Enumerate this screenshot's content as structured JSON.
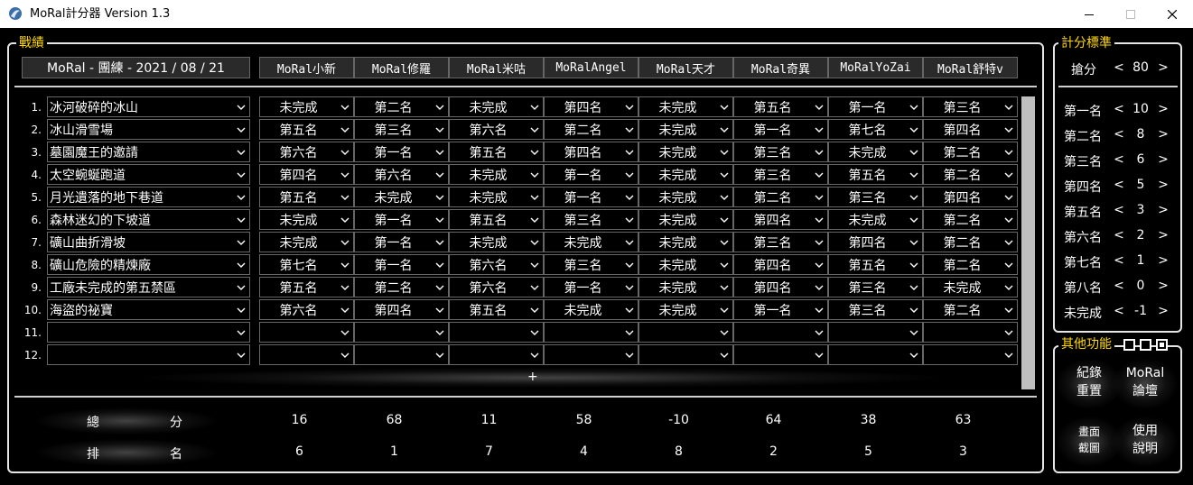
{
  "window": {
    "title": "MoRal計分器 Version 1.3"
  },
  "record": {
    "legend": "戰績",
    "title": "MoRal - 團練 - 2021 / 08 / 21"
  },
  "players": [
    "MoRal小新",
    "MoRal修羅",
    "MoRal米咕",
    "MoRalAngel",
    "MoRal天才",
    "MoRal奇異",
    "MoRalYoZai",
    "MoRal舒特v"
  ],
  "rows": [
    {
      "num": "1.",
      "track": "冰河破碎的冰山",
      "results": [
        "未完成",
        "第二名",
        "未完成",
        "第四名",
        "未完成",
        "第五名",
        "第一名",
        "第三名"
      ]
    },
    {
      "num": "2.",
      "track": "冰山滑雪場",
      "results": [
        "第五名",
        "第三名",
        "第六名",
        "第二名",
        "未完成",
        "第一名",
        "第七名",
        "第四名"
      ]
    },
    {
      "num": "3.",
      "track": "墓園魔王的邀請",
      "results": [
        "第六名",
        "第一名",
        "第五名",
        "第四名",
        "未完成",
        "第三名",
        "未完成",
        "第二名"
      ]
    },
    {
      "num": "4.",
      "track": "太空蜿蜒跑道",
      "results": [
        "第四名",
        "第六名",
        "未完成",
        "第一名",
        "未完成",
        "第三名",
        "第五名",
        "第二名"
      ]
    },
    {
      "num": "5.",
      "track": "月光遺落的地下巷道",
      "results": [
        "第五名",
        "未完成",
        "未完成",
        "第一名",
        "未完成",
        "第二名",
        "第三名",
        "第四名"
      ]
    },
    {
      "num": "6.",
      "track": "森林迷幻的下坡道",
      "results": [
        "未完成",
        "第一名",
        "第五名",
        "第三名",
        "未完成",
        "第四名",
        "未完成",
        "第二名"
      ]
    },
    {
      "num": "7.",
      "track": "礦山曲折滑坡",
      "results": [
        "未完成",
        "第一名",
        "未完成",
        "未完成",
        "未完成",
        "第三名",
        "第四名",
        "第二名"
      ]
    },
    {
      "num": "8.",
      "track": "礦山危險的精煉廠",
      "results": [
        "第七名",
        "第一名",
        "第六名",
        "第三名",
        "未完成",
        "第四名",
        "第五名",
        "第二名"
      ]
    },
    {
      "num": "9.",
      "track": "工廠未完成的第五禁區",
      "results": [
        "第五名",
        "第二名",
        "第六名",
        "第一名",
        "未完成",
        "第四名",
        "第三名",
        "未完成"
      ]
    },
    {
      "num": "10.",
      "track": "海盜的祕寶",
      "results": [
        "第六名",
        "第四名",
        "第五名",
        "未完成",
        "未完成",
        "第一名",
        "第三名",
        "第二名"
      ]
    },
    {
      "num": "11.",
      "track": "",
      "results": [
        "",
        "",
        "",
        "",
        "",
        "",
        "",
        ""
      ]
    },
    {
      "num": "12.",
      "track": "",
      "results": [
        "",
        "",
        "",
        "",
        "",
        "",
        "",
        ""
      ]
    }
  ],
  "add_row_label": "+",
  "summary": {
    "total_label": [
      "總",
      "分"
    ],
    "rank_label": [
      "排",
      "名"
    ],
    "totals": [
      "16",
      "68",
      "11",
      "58",
      "-10",
      "64",
      "38",
      "63"
    ],
    "ranks": [
      "6",
      "1",
      "7",
      "4",
      "8",
      "2",
      "5",
      "3"
    ]
  },
  "scoring": {
    "legend": "計分標準",
    "grab": {
      "label": "搶分",
      "value": "80"
    },
    "items": [
      {
        "label": "第一名",
        "value": "10"
      },
      {
        "label": "第二名",
        "value": "8"
      },
      {
        "label": "第三名",
        "value": "6"
      },
      {
        "label": "第四名",
        "value": "5"
      },
      {
        "label": "第五名",
        "value": "3"
      },
      {
        "label": "第六名",
        "value": "2"
      },
      {
        "label": "第七名",
        "value": "1"
      },
      {
        "label": "第八名",
        "value": "0"
      },
      {
        "label": "未完成",
        "value": "-1"
      }
    ],
    "arrow_left": "<",
    "arrow_right": ">"
  },
  "other": {
    "legend": "其他功能",
    "buttons": [
      {
        "name": "reset-record-button",
        "l1": "紀錄",
        "l2": "重置",
        "small": false
      },
      {
        "name": "moral-forum-button",
        "l1": "MoRal",
        "l2": "論壇",
        "small": false
      },
      {
        "name": "screenshot-button",
        "l1": "畫面",
        "l2": "截圖",
        "small": true
      },
      {
        "name": "help-button",
        "l1": "使用",
        "l2": "說明",
        "small": false
      }
    ]
  },
  "colors": {
    "accent": "#ffd800",
    "border": "#e6e6e6",
    "bg": "#000000"
  }
}
